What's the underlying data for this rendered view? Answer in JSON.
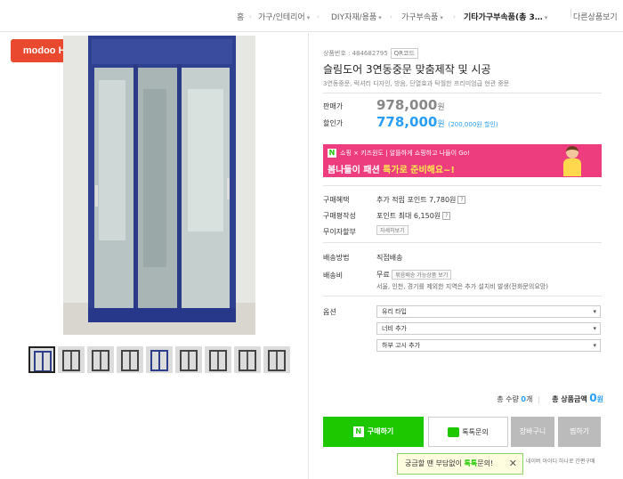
{
  "breadcrumb": {
    "home": "홈",
    "items": [
      "가구/인테리어",
      "DIY자재/용품",
      "가구부속품"
    ],
    "current": "기타가구부속품(총 3…",
    "other": "다른상품보기"
  },
  "logo": "modoo Home",
  "product": {
    "code_label": "상품번호 : 484682795",
    "qr_label": "QR코드",
    "title": "슬림도어 3연동중문 맞춤제작 및 시공",
    "subtitle": "3연동중문, 럭셔리 디자인, 방음, 단열효과 탁월한 프리미엄급 현관 중문"
  },
  "price": {
    "original_label": "판매가",
    "original": "978,000",
    "won": "원",
    "sale_label": "할인가",
    "sale": "778,000",
    "sale_note": "(200,000원 할인)"
  },
  "banner": {
    "badge": "N",
    "line1": "쇼핑 × 키즈원도 | 알뜰하게 쇼핑하고 나들이 Go!",
    "line2_prefix": "봄나들이 패션 ",
    "line2_highlight": "특가로 준비해요~!"
  },
  "benefits": {
    "purchase_label": "구매혜택",
    "purchase_value": "추가 적립 포인트 7,780원",
    "review_label": "구매평작성",
    "review_value": "포인트 최대 6,150원",
    "installment_label": "무이자할부",
    "installment_button": "자세히보기"
  },
  "shipping": {
    "method_label": "배송방법",
    "method_value": "직접배송",
    "fee_label": "배송비",
    "fee_value": "무료",
    "fee_button": "묶음배송 가능상품 보기",
    "note": "서울, 인천, 경기를 제외한 지역은 추가 설치비 발생(전화문의요망)"
  },
  "options": {
    "label": "옵션",
    "selects": [
      "유리 타입",
      "너비 추가",
      "하부 고시 추가"
    ]
  },
  "total": {
    "qty_prefix": "총 수량 ",
    "qty": "0",
    "qty_unit": "개",
    "amount_label": "총 상품금액",
    "amount": "0",
    "won": "원"
  },
  "buttons": {
    "buy_badge": "N",
    "buy": "구매하기",
    "talk": "톡톡문의",
    "cart": "장바구니",
    "wish": "찜하기"
  },
  "tooltip": {
    "prefix": "궁금할 땐 부담없이 ",
    "highlight": "톡톡",
    "suffix": "문의!",
    "close": "✕",
    "after": "네이버 아이디 하나로 간편구매"
  },
  "thumbnail_count": 9,
  "colors": {
    "naver_green": "#1ec800",
    "price_blue": "#2a9df4",
    "banner_pink": "#ee3d7e",
    "logo_red": "#e9492e",
    "door_frame": "#2d3f8a"
  }
}
